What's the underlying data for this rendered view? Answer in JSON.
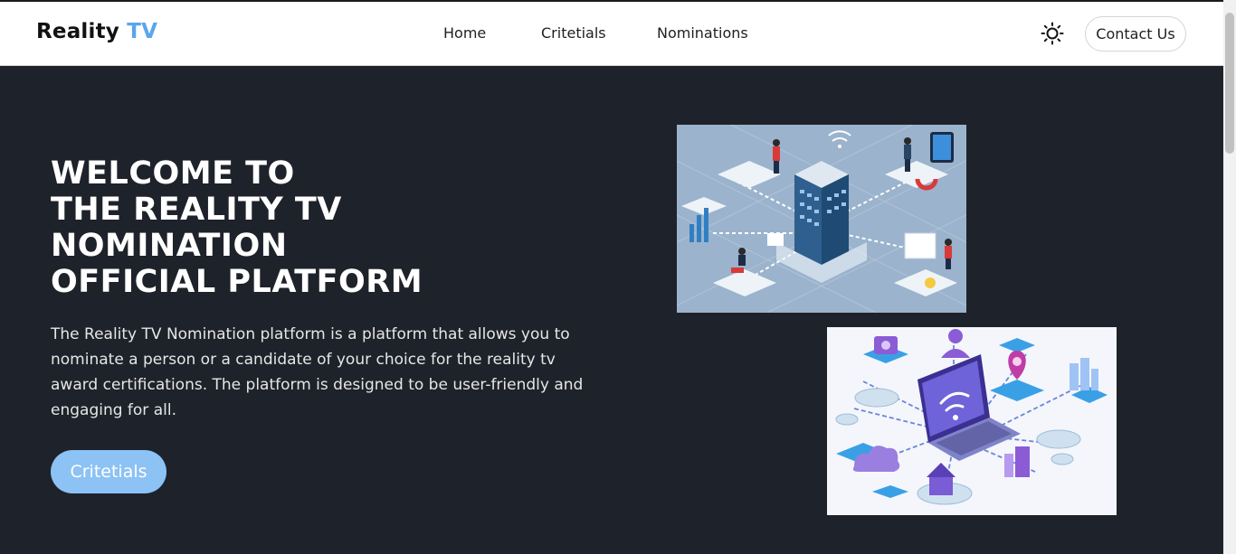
{
  "brand": {
    "name": "Reality",
    "accent": "TV"
  },
  "nav": {
    "links": [
      {
        "label": "Home"
      },
      {
        "label": "Critetials"
      },
      {
        "label": "Nominations"
      }
    ],
    "theme_icon": "sun-icon",
    "contact_label": "Contact Us"
  },
  "hero": {
    "title_lines": [
      "WELCOME TO",
      "THE REALITY TV",
      "NOMINATION",
      "OFFICIAL PLATFORM"
    ],
    "description": "The Reality TV Nomination platform is a platform that allows you to nominate a person or a candidate of your choice for the reality tv award certifications. The platform is designed to be user-friendly and engaging for all.",
    "cta_label": "Critetials"
  },
  "colors": {
    "accent": "#5aa6ec",
    "background": "#1e222a",
    "cta": "#8cc2f4",
    "navbar": "#ffffff"
  }
}
